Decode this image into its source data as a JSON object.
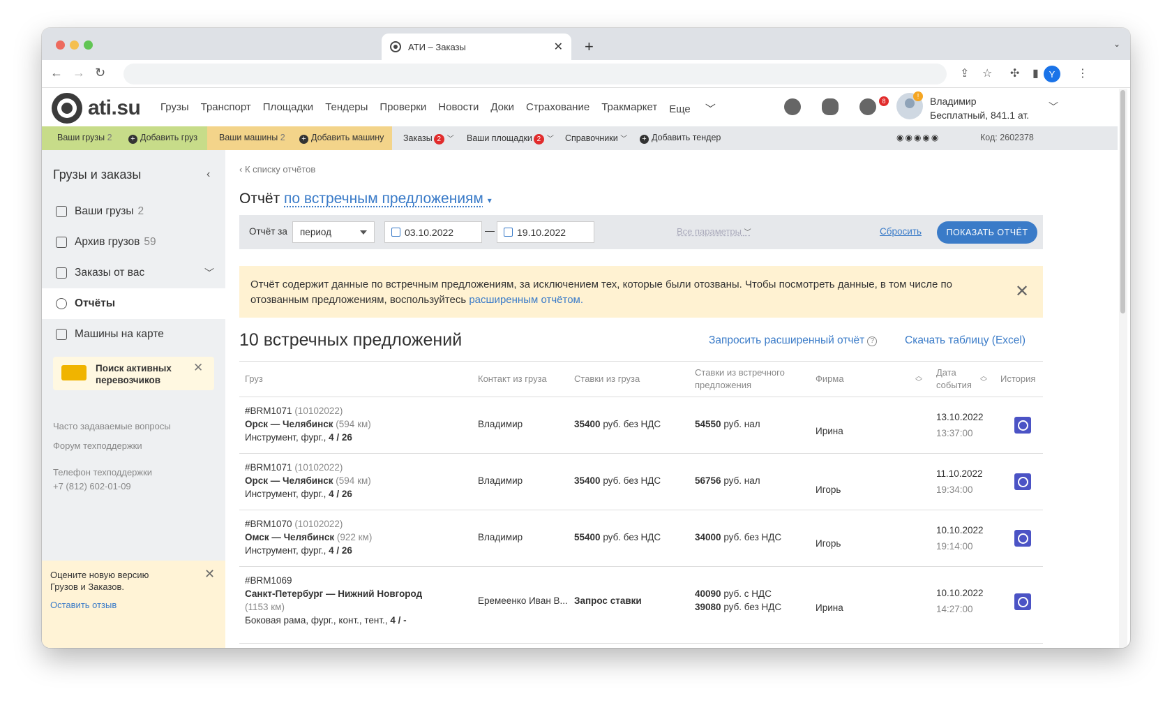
{
  "browser": {
    "tab_title": "АТИ – Заказы",
    "profile_initial": "Y"
  },
  "site": {
    "logo_text": "ati.su",
    "nav": [
      "Грузы",
      "Транспорт",
      "Площадки",
      "Тендеры",
      "Проверки",
      "Новости",
      "Доки",
      "Страхование",
      "Тракмаркет",
      "Еще"
    ],
    "notif_count": "8",
    "user_badge": "!",
    "user_name": "Владимир",
    "user_plan": "Бесплатный,  841.1 ат."
  },
  "subbar": {
    "your_cargo": "Ваши грузы",
    "your_cargo_count": "2",
    "add_cargo": "Добавить груз",
    "your_trucks": "Ваши машины",
    "your_trucks_count": "2",
    "add_truck": "Добавить машину",
    "orders": "Заказы",
    "orders_count": "2",
    "your_sites": "Ваши площадки",
    "your_sites_count": "2",
    "directories": "Справочники",
    "add_tender": "Добавить тендер",
    "code": "Код: 2602378"
  },
  "sidebar": {
    "title": "Грузы и заказы",
    "items": [
      {
        "label": "Ваши грузы",
        "count": "2"
      },
      {
        "label": "Архив грузов",
        "count": "59"
      },
      {
        "label": "Заказы от вас",
        "count": ""
      },
      {
        "label": "Отчёты",
        "count": ""
      },
      {
        "label": "Машины на карте",
        "count": ""
      }
    ],
    "promo": "Поиск активных перевозчиков",
    "faq": "Часто задаваемые вопросы",
    "forum": "Форум техподдержки",
    "phone_label": "Телефон техподдержки",
    "phone": "+7 (812) 602-01-09",
    "rate_text": "Оцените новую версию Грузов и Заказов.",
    "rate_link": "Оставить отзыв"
  },
  "report": {
    "back": "К списку отчётов",
    "title_prefix": "Отчёт",
    "title_link": "по встречным предложениям",
    "filter_label": "Отчёт за",
    "period": "период",
    "date_from": "03.10.2022",
    "date_to": "19.10.2022",
    "all_params": "Все параметры",
    "reset": "Сбросить",
    "show": "ПОКАЗАТЬ ОТЧЁТ",
    "notice": "Отчёт содержит данные по встречным предложениям, за исключением тех, которые были отозваны. Чтобы посмотреть данные, в том числе по отозванным предложениям, воспользуйтесь ",
    "notice_link": "расширенным отчётом.",
    "count_title": "10 встречных предложений",
    "request_ext": "Запросить расширенный отчёт",
    "download": "Скачать таблицу (Excel)"
  },
  "table": {
    "headers": {
      "cargo": "Груз",
      "contact": "Контакт из груза",
      "rates": "Ставки из груза",
      "counter": "Ставки из встречного предложения",
      "firm": "Фирма",
      "date": "Дата события",
      "history": "История"
    },
    "rows": [
      {
        "id": "#BRM1071",
        "id_date": "(10102022)",
        "route": "Орск — Челябинск",
        "dist": "(594 км)",
        "desc": "Инструмент, фург.,",
        "desc_b": "4 / 26",
        "contact": "Владимир",
        "rate_num": "35400",
        "rate_rest": "руб. без НДС",
        "c1_num": "54550",
        "c1_rest": "руб. нал",
        "c2_num": "",
        "c2_rest": "",
        "firm": "Ирина",
        "date": "13.10.2022",
        "time": "13:37:00"
      },
      {
        "id": "#BRM1071",
        "id_date": "(10102022)",
        "route": "Орск — Челябинск",
        "dist": "(594 км)",
        "desc": "Инструмент, фург.,",
        "desc_b": "4 / 26",
        "contact": "Владимир",
        "rate_num": "35400",
        "rate_rest": "руб. без НДС",
        "c1_num": "56756",
        "c1_rest": "руб. нал",
        "c2_num": "",
        "c2_rest": "",
        "firm": "Игорь",
        "date": "11.10.2022",
        "time": "19:34:00"
      },
      {
        "id": "#BRM1070",
        "id_date": "(10102022)",
        "route": "Омск — Челябинск",
        "dist": "(922 км)",
        "desc": "Инструмент, фург.,",
        "desc_b": "4 / 26",
        "contact": "Владимир",
        "rate_num": "55400",
        "rate_rest": "руб. без НДС",
        "c1_num": "34000",
        "c1_rest": "руб. без НДС",
        "c2_num": "",
        "c2_rest": "",
        "firm": "Игорь",
        "date": "10.10.2022",
        "time": "19:14:00"
      },
      {
        "id": "#BRM1069",
        "id_date": "",
        "route": "Санкт-Петербург — Нижний Новгород",
        "dist": "(1153 км)",
        "desc": "Боковая рама, фург., конт., тент.,",
        "desc_b": "4 / -",
        "contact": "Еремеенко Иван В...",
        "rate_num": "Запрос ставки",
        "rate_rest": "",
        "c1_num": "40090",
        "c1_rest": "руб. с НДС",
        "c2_num": "39080",
        "c2_rest": "руб. без НДС",
        "firm": "Ирина",
        "date": "10.10.2022",
        "time": "14:27:00"
      }
    ]
  }
}
